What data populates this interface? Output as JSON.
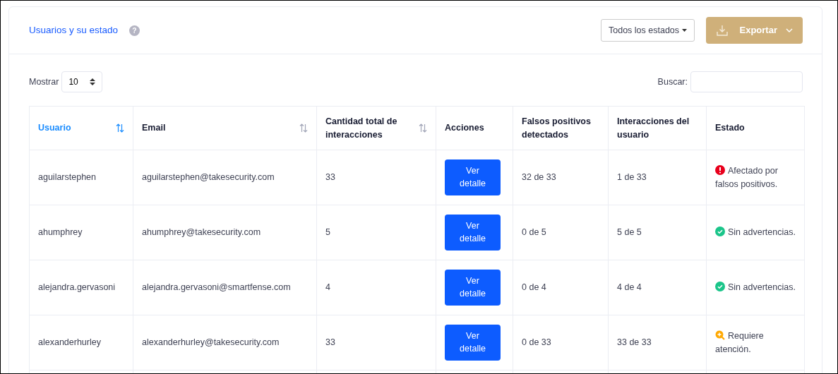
{
  "card": {
    "title": "Usuarios y su estado",
    "help": "?",
    "filter": {
      "label": "Todos los estados"
    },
    "export_button": {
      "label": "Exportar"
    }
  },
  "length": {
    "label": "Mostrar",
    "value": "10"
  },
  "search": {
    "label": "Buscar:"
  },
  "table": {
    "columns": [
      {
        "label": "Usuario",
        "sortable": true,
        "sorted": true
      },
      {
        "label": "Email",
        "sortable": true,
        "sorted": false
      },
      {
        "label": "Cantidad total de interacciones",
        "sortable": true,
        "sorted": false
      },
      {
        "label": "Acciones",
        "sortable": false,
        "sorted": false
      },
      {
        "label": "Falsos positivos detectados",
        "sortable": false,
        "sorted": false
      },
      {
        "label": "Interacciones del usuario",
        "sortable": false,
        "sorted": false
      },
      {
        "label": "Estado",
        "sortable": false,
        "sorted": false
      }
    ],
    "rows": [
      {
        "user": "aguilarstephen",
        "email": "aguilarstephen@takesecurity.com",
        "total": "33",
        "action": "Ver detalle",
        "false_positives": "32 de 33",
        "interactions": "1 de 33",
        "status": {
          "kind": "error",
          "text": "Afectado por falsos positivos."
        }
      },
      {
        "user": "ahumphrey",
        "email": "ahumphrey@takesecurity.com",
        "total": "5",
        "action": "Ver detalle",
        "false_positives": "0 de 5",
        "interactions": "5 de 5",
        "status": {
          "kind": "ok",
          "text": "Sin advertencias."
        }
      },
      {
        "user": "alejandra.gervasoni",
        "email": "alejandra.gervasoni@smartfense.com",
        "total": "4",
        "action": "Ver detalle",
        "false_positives": "0 de 4",
        "interactions": "4 de 4",
        "status": {
          "kind": "ok",
          "text": "Sin advertencias."
        }
      },
      {
        "user": "alexanderhurley",
        "email": "alexanderhurley@takesecurity.com",
        "total": "33",
        "action": "Ver detalle",
        "false_positives": "0 de 33",
        "interactions": "33 de 33",
        "status": {
          "kind": "warning",
          "text": "Requiere atención."
        }
      }
    ]
  }
}
